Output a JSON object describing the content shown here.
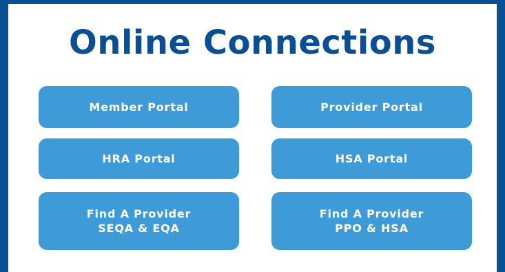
{
  "page": {
    "title": "Online Connections",
    "colors": {
      "border": "#0b4f93",
      "title": "#0b4f93",
      "button": "#3f9ad8",
      "button_text": "#ffffff",
      "background": "#ffffff"
    }
  },
  "buttons": {
    "member_portal": "Member Portal",
    "provider_portal": "Provider Portal",
    "hra_portal": "HRA Portal",
    "hsa_portal": "HSA Portal",
    "find_provider_seqa": {
      "line1": "Find A Provider",
      "line2": "SEQA & EQA"
    },
    "find_provider_ppo": {
      "line1": "Find A Provider",
      "line2": "PPO & HSA"
    }
  }
}
